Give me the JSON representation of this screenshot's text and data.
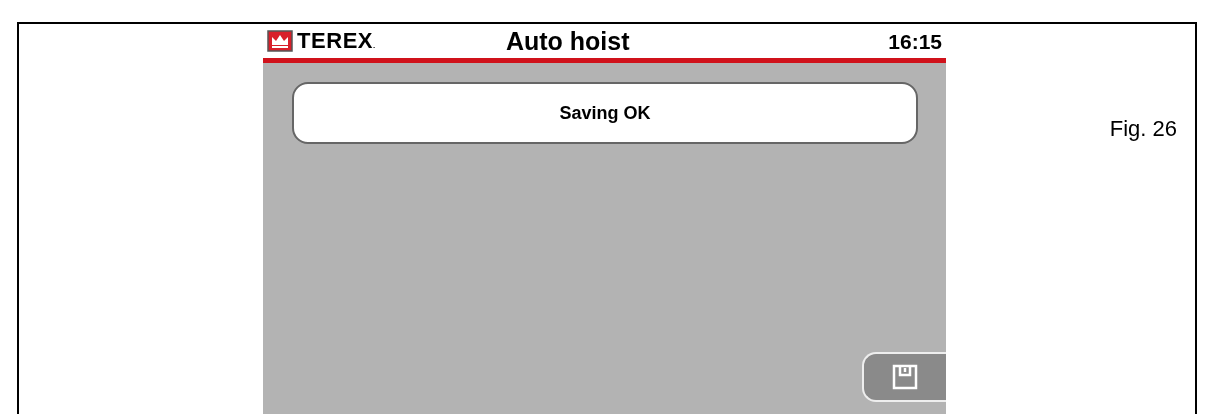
{
  "screen": {
    "brand": "TEREX",
    "brand_mark": ".",
    "title": "Auto hoist",
    "time": "16:15",
    "message": "Saving OK"
  },
  "caption": "Fig. 26"
}
